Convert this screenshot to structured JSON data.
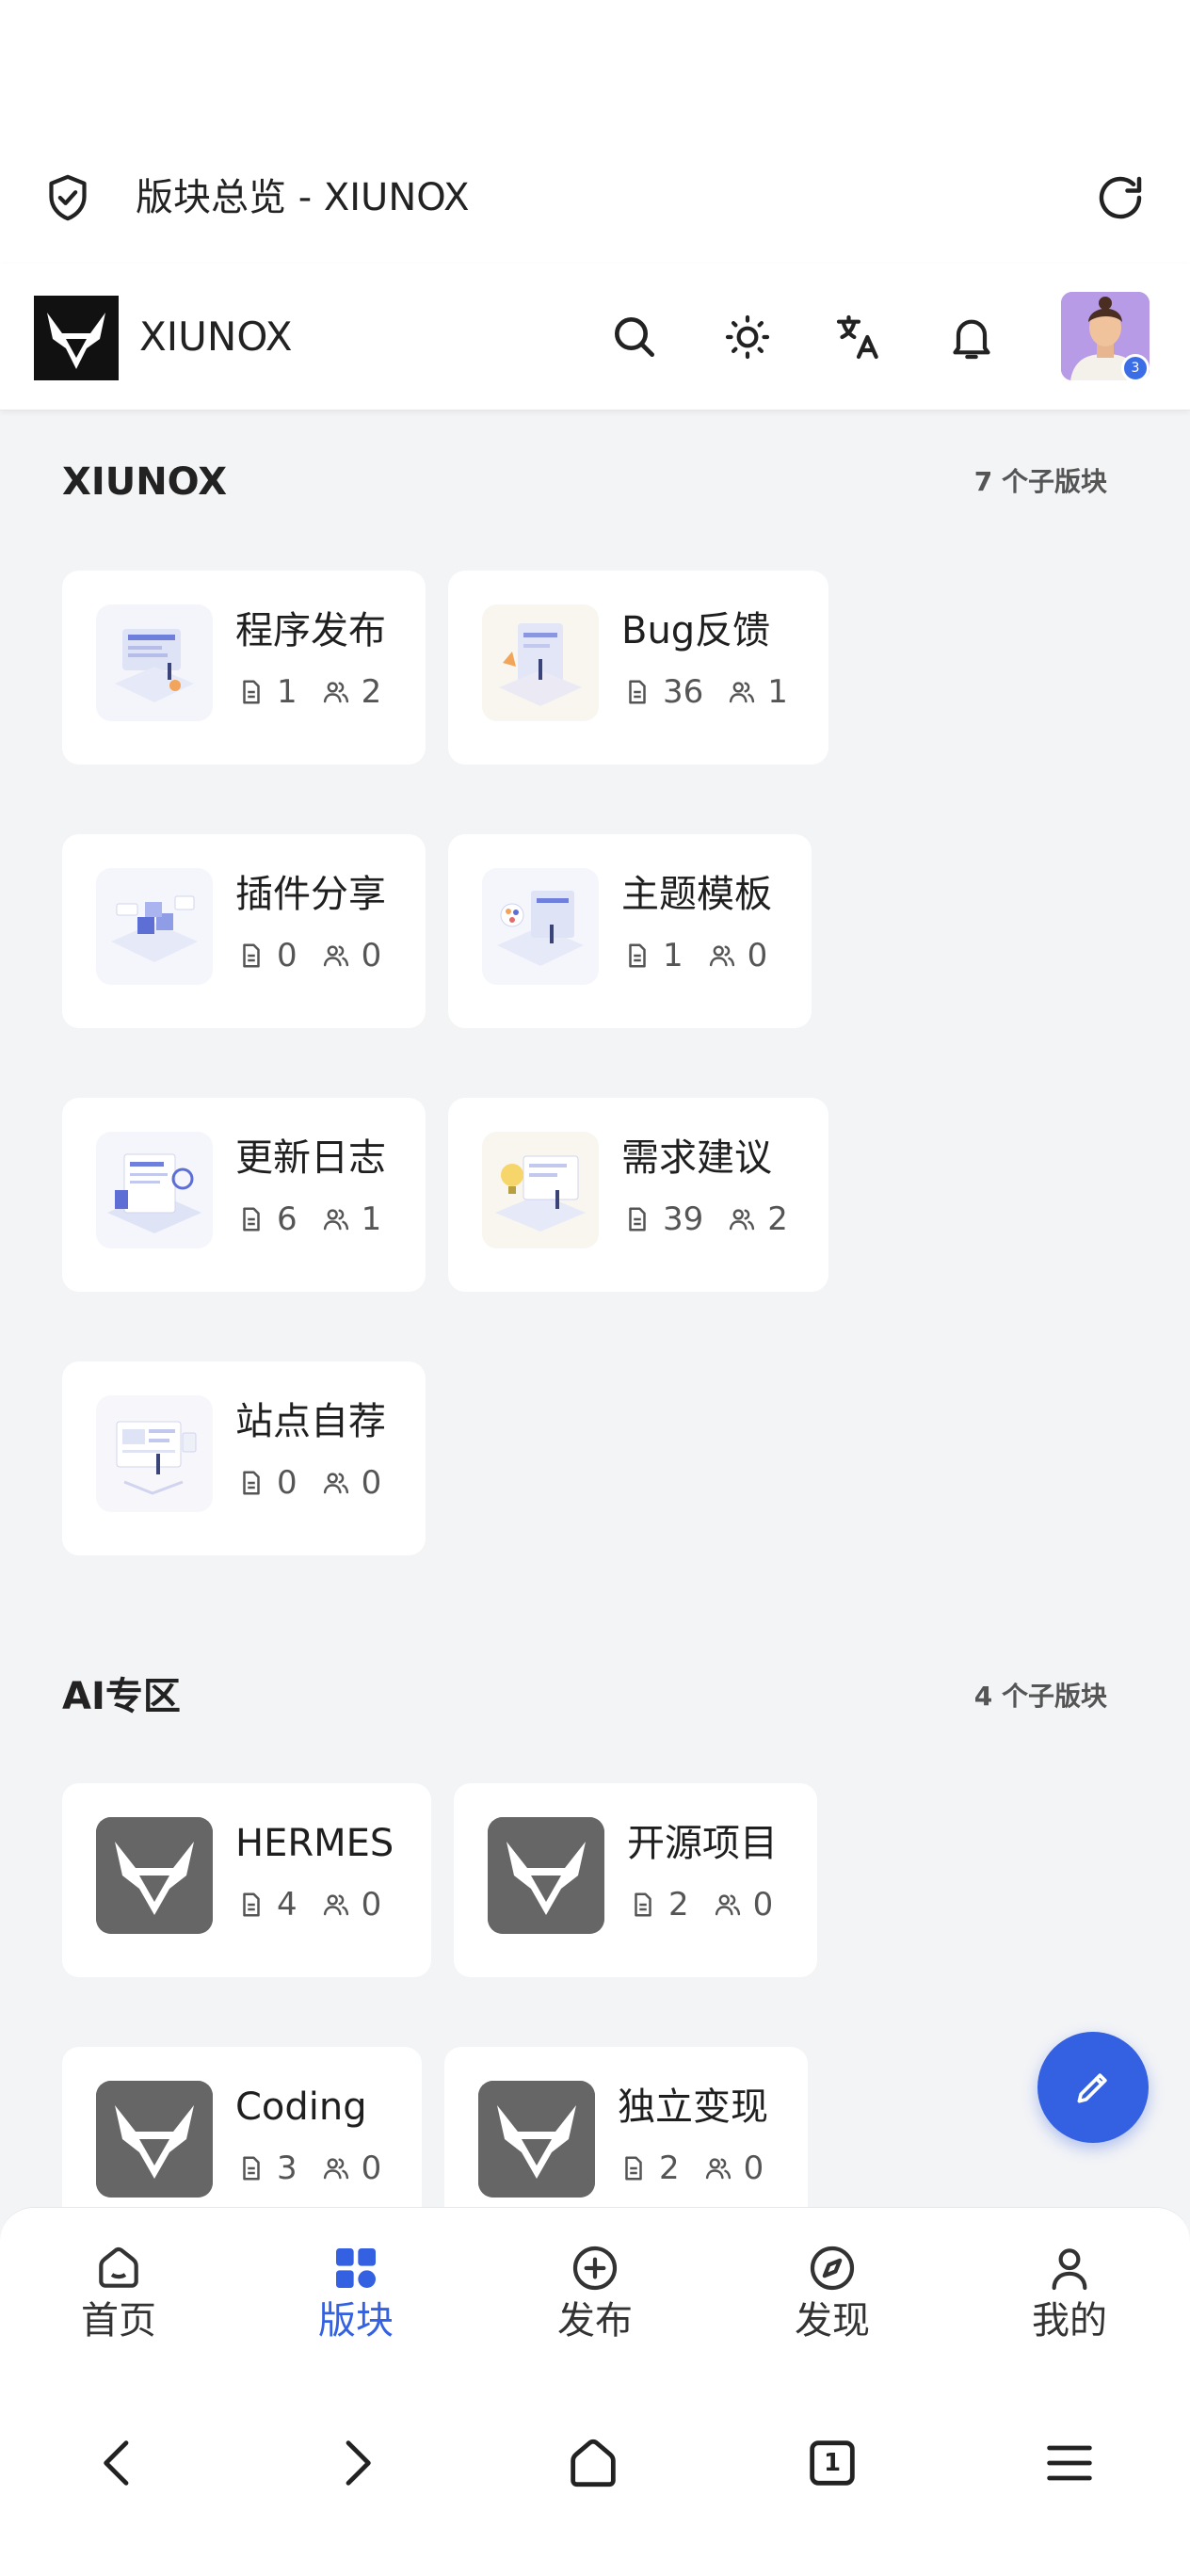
{
  "browser": {
    "page_title": "版块总览 - XIUNOX"
  },
  "header": {
    "brand": "XIUNOX",
    "avatar_badge": "3"
  },
  "sections": [
    {
      "title": "XIUNOX",
      "count": "7 个子版块",
      "boards": [
        {
          "name": "程序发布",
          "posts": "1",
          "members": "2"
        },
        {
          "name": "Bug反馈",
          "posts": "36",
          "members": "1"
        },
        {
          "name": "插件分享",
          "posts": "0",
          "members": "0"
        },
        {
          "name": "主题模板",
          "posts": "1",
          "members": "0"
        },
        {
          "name": "更新日志",
          "posts": "6",
          "members": "1"
        },
        {
          "name": "需求建议",
          "posts": "39",
          "members": "2"
        },
        {
          "name": "站点自荐",
          "posts": "0",
          "members": "0"
        }
      ]
    },
    {
      "title": "AI专区",
      "count": "4 个子版块",
      "boards": [
        {
          "name": "HERMES",
          "posts": "4",
          "members": "0"
        },
        {
          "name": "开源项目",
          "posts": "2",
          "members": "0"
        },
        {
          "name": "Coding",
          "posts": "3",
          "members": "0"
        },
        {
          "name": "独立变现",
          "posts": "2",
          "members": "0"
        }
      ]
    }
  ],
  "bottom_nav": [
    {
      "label": "首页",
      "icon": "home-icon"
    },
    {
      "label": "版块",
      "icon": "grid-icon",
      "active": true
    },
    {
      "label": "发布",
      "icon": "plus-circle-icon"
    },
    {
      "label": "发现",
      "icon": "compass-icon"
    },
    {
      "label": "我的",
      "icon": "user-icon"
    }
  ],
  "browser_toolbar": {
    "tab_count": "1"
  },
  "colors": {
    "accent": "#3461e2",
    "background": "#f3f4f6",
    "card": "#ffffff"
  }
}
